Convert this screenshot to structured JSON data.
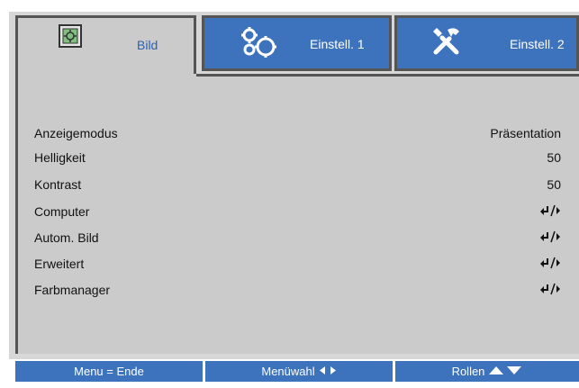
{
  "tabs": [
    {
      "label": "Bild",
      "icon": "picture-icon",
      "active": true
    },
    {
      "label": "Einstell. 1",
      "icon": "gears-icon",
      "active": false
    },
    {
      "label": "Einstell. 2",
      "icon": "tools-icon",
      "active": false
    }
  ],
  "rows": [
    {
      "label": "Anzeigemodus",
      "value": "Präsentation"
    },
    {
      "label": "Helligkeit",
      "value": "50"
    },
    {
      "label": "Kontrast",
      "value": "50"
    },
    {
      "label": "Computer",
      "value": "enter-arrow-icon"
    },
    {
      "label": "Autom. Bild",
      "value": "enter-arrow-icon"
    },
    {
      "label": "Erweitert",
      "value": "enter-arrow-icon"
    },
    {
      "label": "Farbmanager",
      "value": "enter-arrow-icon"
    }
  ],
  "footer": {
    "menu": "Menu = Ende",
    "select": "Menüwahl",
    "scroll": "Rollen"
  },
  "colors": {
    "tab_blue": "#3d72bd",
    "panel_gray": "#cbcbcb",
    "border_dark": "#555555",
    "active_label": "#2d5fb5"
  }
}
